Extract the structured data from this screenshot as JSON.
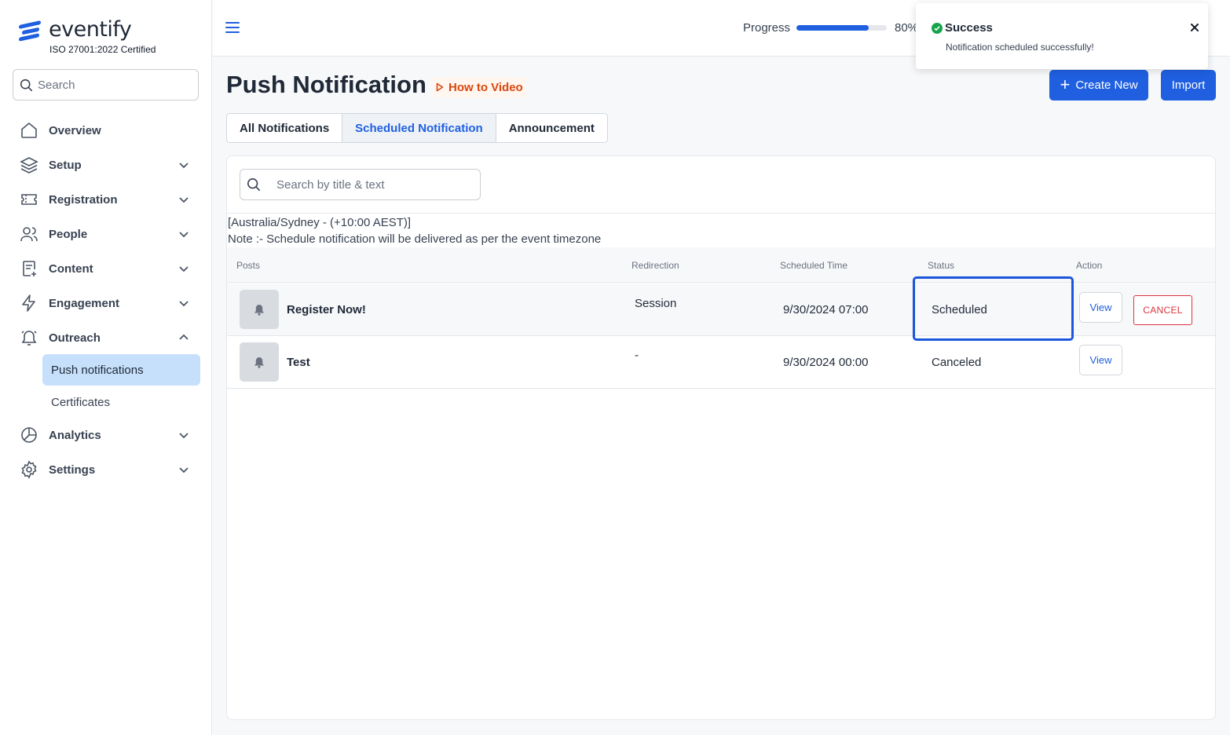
{
  "brand": {
    "name": "eventify",
    "certification": "ISO 27001:2022 Certified",
    "accent": "#1f5fe0"
  },
  "sidebar": {
    "search_placeholder": "Search",
    "items": [
      {
        "label": "Overview",
        "icon": "home-icon"
      },
      {
        "label": "Setup",
        "icon": "layers-icon"
      },
      {
        "label": "Registration",
        "icon": "ticket-icon"
      },
      {
        "label": "People",
        "icon": "users-icon"
      },
      {
        "label": "Content",
        "icon": "document-plus-icon"
      },
      {
        "label": "Engagement",
        "icon": "lightning-icon"
      },
      {
        "label": "Outreach",
        "icon": "bell-icon"
      },
      {
        "label": "Analytics",
        "icon": "pie-chart-icon"
      },
      {
        "label": "Settings",
        "icon": "gear-icon"
      }
    ],
    "outreach_sub": [
      {
        "label": "Push notifications",
        "active": true
      },
      {
        "label": "Certificates",
        "active": false
      }
    ]
  },
  "header": {
    "progress_label": "Progress",
    "progress_value": 0.8,
    "progress_text": "80%"
  },
  "toast": {
    "title": "Success",
    "message": "Notification scheduled successfully!",
    "status_color": "#16a34a"
  },
  "page": {
    "title": "Push Notification",
    "how_to": "How to Video",
    "create_new": "Create New",
    "import": "Import",
    "tabs": [
      {
        "label": "All Notifications",
        "active": false
      },
      {
        "label": "Scheduled Notification",
        "active": true
      },
      {
        "label": "Announcement",
        "active": false
      }
    ],
    "table_search_placeholder": "Search by title & text",
    "timezone": "[Australia/Sydney - (+10:00 AEST)]",
    "note": "Note :- Schedule notification will be delivered as per the event timezone"
  },
  "table": {
    "columns": [
      "Posts",
      "Redirection",
      "Scheduled Time",
      "Status",
      "Action"
    ],
    "rows": [
      {
        "title": "Register Now!",
        "redirection": "Session",
        "time": "9/30/2024 07:00",
        "status": "Scheduled",
        "view": "View",
        "cancel": "CANCEL"
      },
      {
        "title": "Test",
        "redirection": "-",
        "time": "9/30/2024 00:00",
        "status": "Canceled",
        "view": "View"
      }
    ]
  }
}
